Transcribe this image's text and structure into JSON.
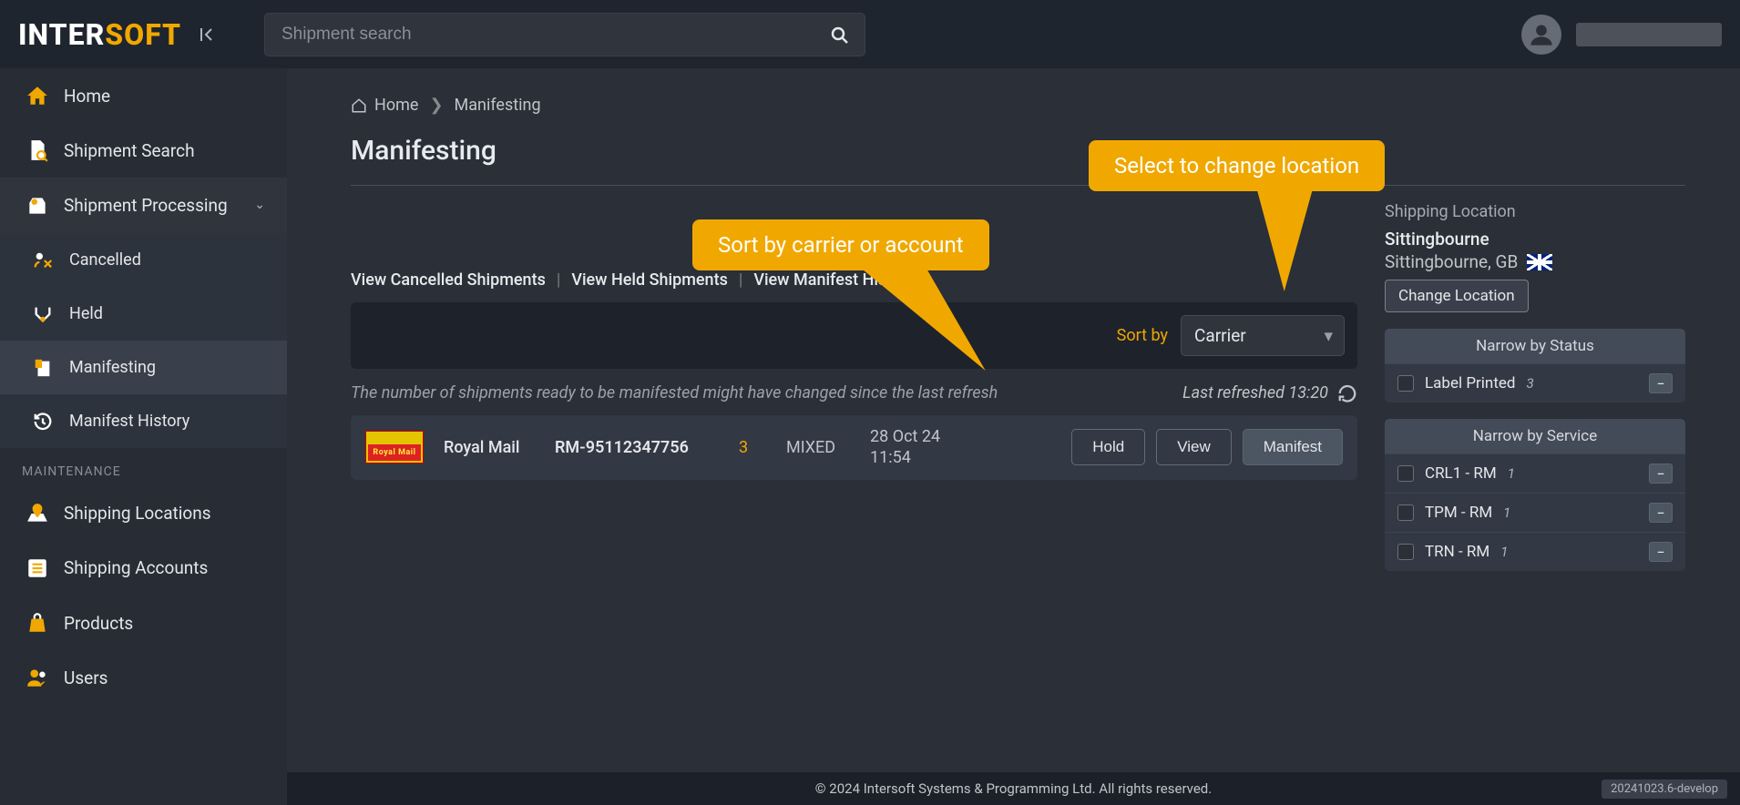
{
  "brand": {
    "part1": "INTER",
    "part2": "SOFT"
  },
  "search": {
    "placeholder": "Shipment search"
  },
  "sidebar": {
    "items": [
      {
        "label": "Home",
        "icon": "home"
      },
      {
        "label": "Shipment Search",
        "icon": "doc-search"
      },
      {
        "label": "Shipment Processing",
        "icon": "processing",
        "expanded": true
      },
      {
        "label": "Cancelled",
        "icon": "cancel",
        "sub": true
      },
      {
        "label": "Held",
        "icon": "held",
        "sub": true
      },
      {
        "label": "Manifesting",
        "icon": "manifest",
        "sub": true,
        "active": true
      },
      {
        "label": "Manifest History",
        "icon": "history",
        "sub": true
      }
    ],
    "section_label": "MAINTENANCE",
    "maintenance": [
      {
        "label": "Shipping Locations",
        "icon": "pin"
      },
      {
        "label": "Shipping Accounts",
        "icon": "list"
      },
      {
        "label": "Products",
        "icon": "bag"
      },
      {
        "label": "Users",
        "icon": "users"
      }
    ]
  },
  "breadcrumb": {
    "home": "Home",
    "current": "Manifesting"
  },
  "page_title": "Manifesting",
  "action_links": {
    "cancelled": "View Cancelled Shipments",
    "held": "View Held Shipments",
    "history": "View Manifest History"
  },
  "sort": {
    "label": "Sort by",
    "value": "Carrier"
  },
  "refresh": {
    "note": "The number of shipments ready to be manifested might have changed since the last refresh",
    "last": "Last refreshed 13:20"
  },
  "shipments": [
    {
      "carrier": "Royal Mail",
      "account": "RM-95112347756",
      "count": "3",
      "dest": "MIXED",
      "date_line1": "28 Oct 24",
      "date_line2": "11:54"
    }
  ],
  "buttons": {
    "hold": "Hold",
    "view": "View",
    "manifest": "Manifest"
  },
  "location": {
    "title": "Shipping Location",
    "name": "Sittingbourne",
    "sub": "Sittingbourne, GB",
    "change": "Change Location"
  },
  "status_panel": {
    "title": "Narrow by Status",
    "items": [
      {
        "label": "Label Printed",
        "count": "3"
      }
    ]
  },
  "service_panel": {
    "title": "Narrow by Service",
    "items": [
      {
        "label": "CRL1 - RM",
        "count": "1"
      },
      {
        "label": "TPM - RM",
        "count": "1"
      },
      {
        "label": "TRN - RM",
        "count": "1"
      }
    ]
  },
  "callouts": {
    "c1": "Sort by carrier or account",
    "c2": "Select to change location"
  },
  "footer": {
    "copyright": "© 2024 Intersoft Systems & Programming Ltd. All rights reserved.",
    "build": "20241023.6-develop"
  }
}
